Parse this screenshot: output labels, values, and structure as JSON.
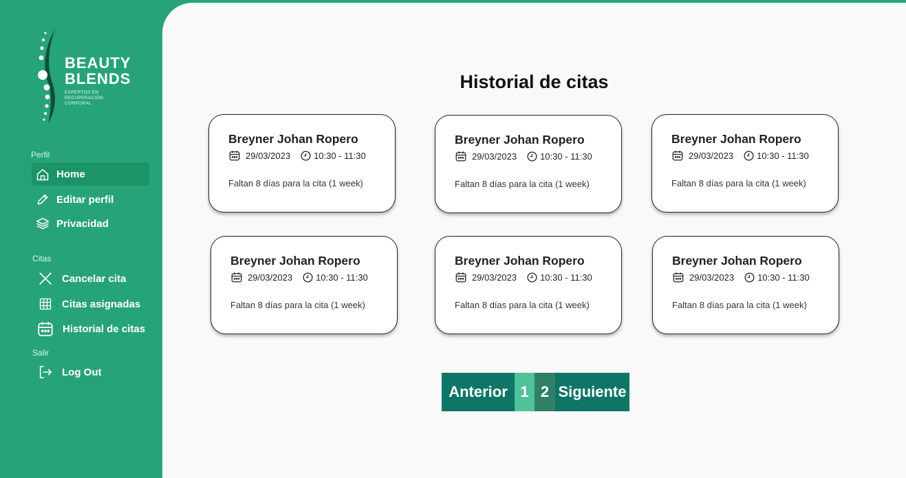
{
  "brand": {
    "line1": "BEAUTY",
    "line2": "BLENDS",
    "tagline": "EXPERTOS EN RECUPERACIÓN CORPORAL"
  },
  "sidebar": {
    "sections": [
      {
        "label": "Perfil",
        "items": [
          {
            "label": "Home",
            "icon": "home-icon",
            "active": true
          },
          {
            "label": "Editar perfil",
            "icon": "pencil-icon"
          },
          {
            "label": "Privacidad",
            "icon": "layers-icon"
          }
        ]
      },
      {
        "label": "Citas",
        "items": [
          {
            "label": "Cancelar cita",
            "icon": "close-icon"
          },
          {
            "label": "Citas asignadas",
            "icon": "grid-icon"
          },
          {
            "label": "Historial de citas",
            "icon": "calendar-icon"
          }
        ]
      },
      {
        "label": "Salir",
        "items": [
          {
            "label": "Log Out",
            "icon": "logout-icon"
          }
        ]
      }
    ]
  },
  "main": {
    "title": "Historial de citas",
    "cards": [
      {
        "name": "Breyner Johan Ropero",
        "date": "29/03/2023",
        "time": "10:30 - 11:30",
        "note": "Faltan 8 días para la cita (1 week)"
      },
      {
        "name": "Breyner Johan Ropero",
        "date": "29/03/2023",
        "time": "10:30 - 11:30",
        "note": "Faltan 8 días para la cita (1 week)"
      },
      {
        "name": "Breyner Johan Ropero",
        "date": "29/03/2023",
        "time": "10:30 - 11:30",
        "note": "Faltan 8 días para la cita (1 week)"
      },
      {
        "name": "Breyner Johan Ropero",
        "date": "29/03/2023",
        "time": "10:30 - 11:30",
        "note": "Faltan 8 días para la cita (1 week)"
      },
      {
        "name": "Breyner Johan Ropero",
        "date": "29/03/2023",
        "time": "10:30 - 11:30",
        "note": "Faltan 8 días para la cita (1 week)"
      },
      {
        "name": "Breyner Johan Ropero",
        "date": "29/03/2023",
        "time": "10:30 - 11:30",
        "note": "Faltan 8 días para la cita (1 week)"
      }
    ],
    "pagination": {
      "prev_label": "Anterior",
      "pages": [
        "1",
        "2"
      ],
      "next_label": "Siguiente"
    }
  },
  "colors": {
    "sidebar_bg": "#27a37a",
    "active_item_bg": "#1b9468",
    "pager_dark": "#0f7566",
    "pager_page1": "#4fc19b",
    "pager_page2": "#2f8066"
  }
}
